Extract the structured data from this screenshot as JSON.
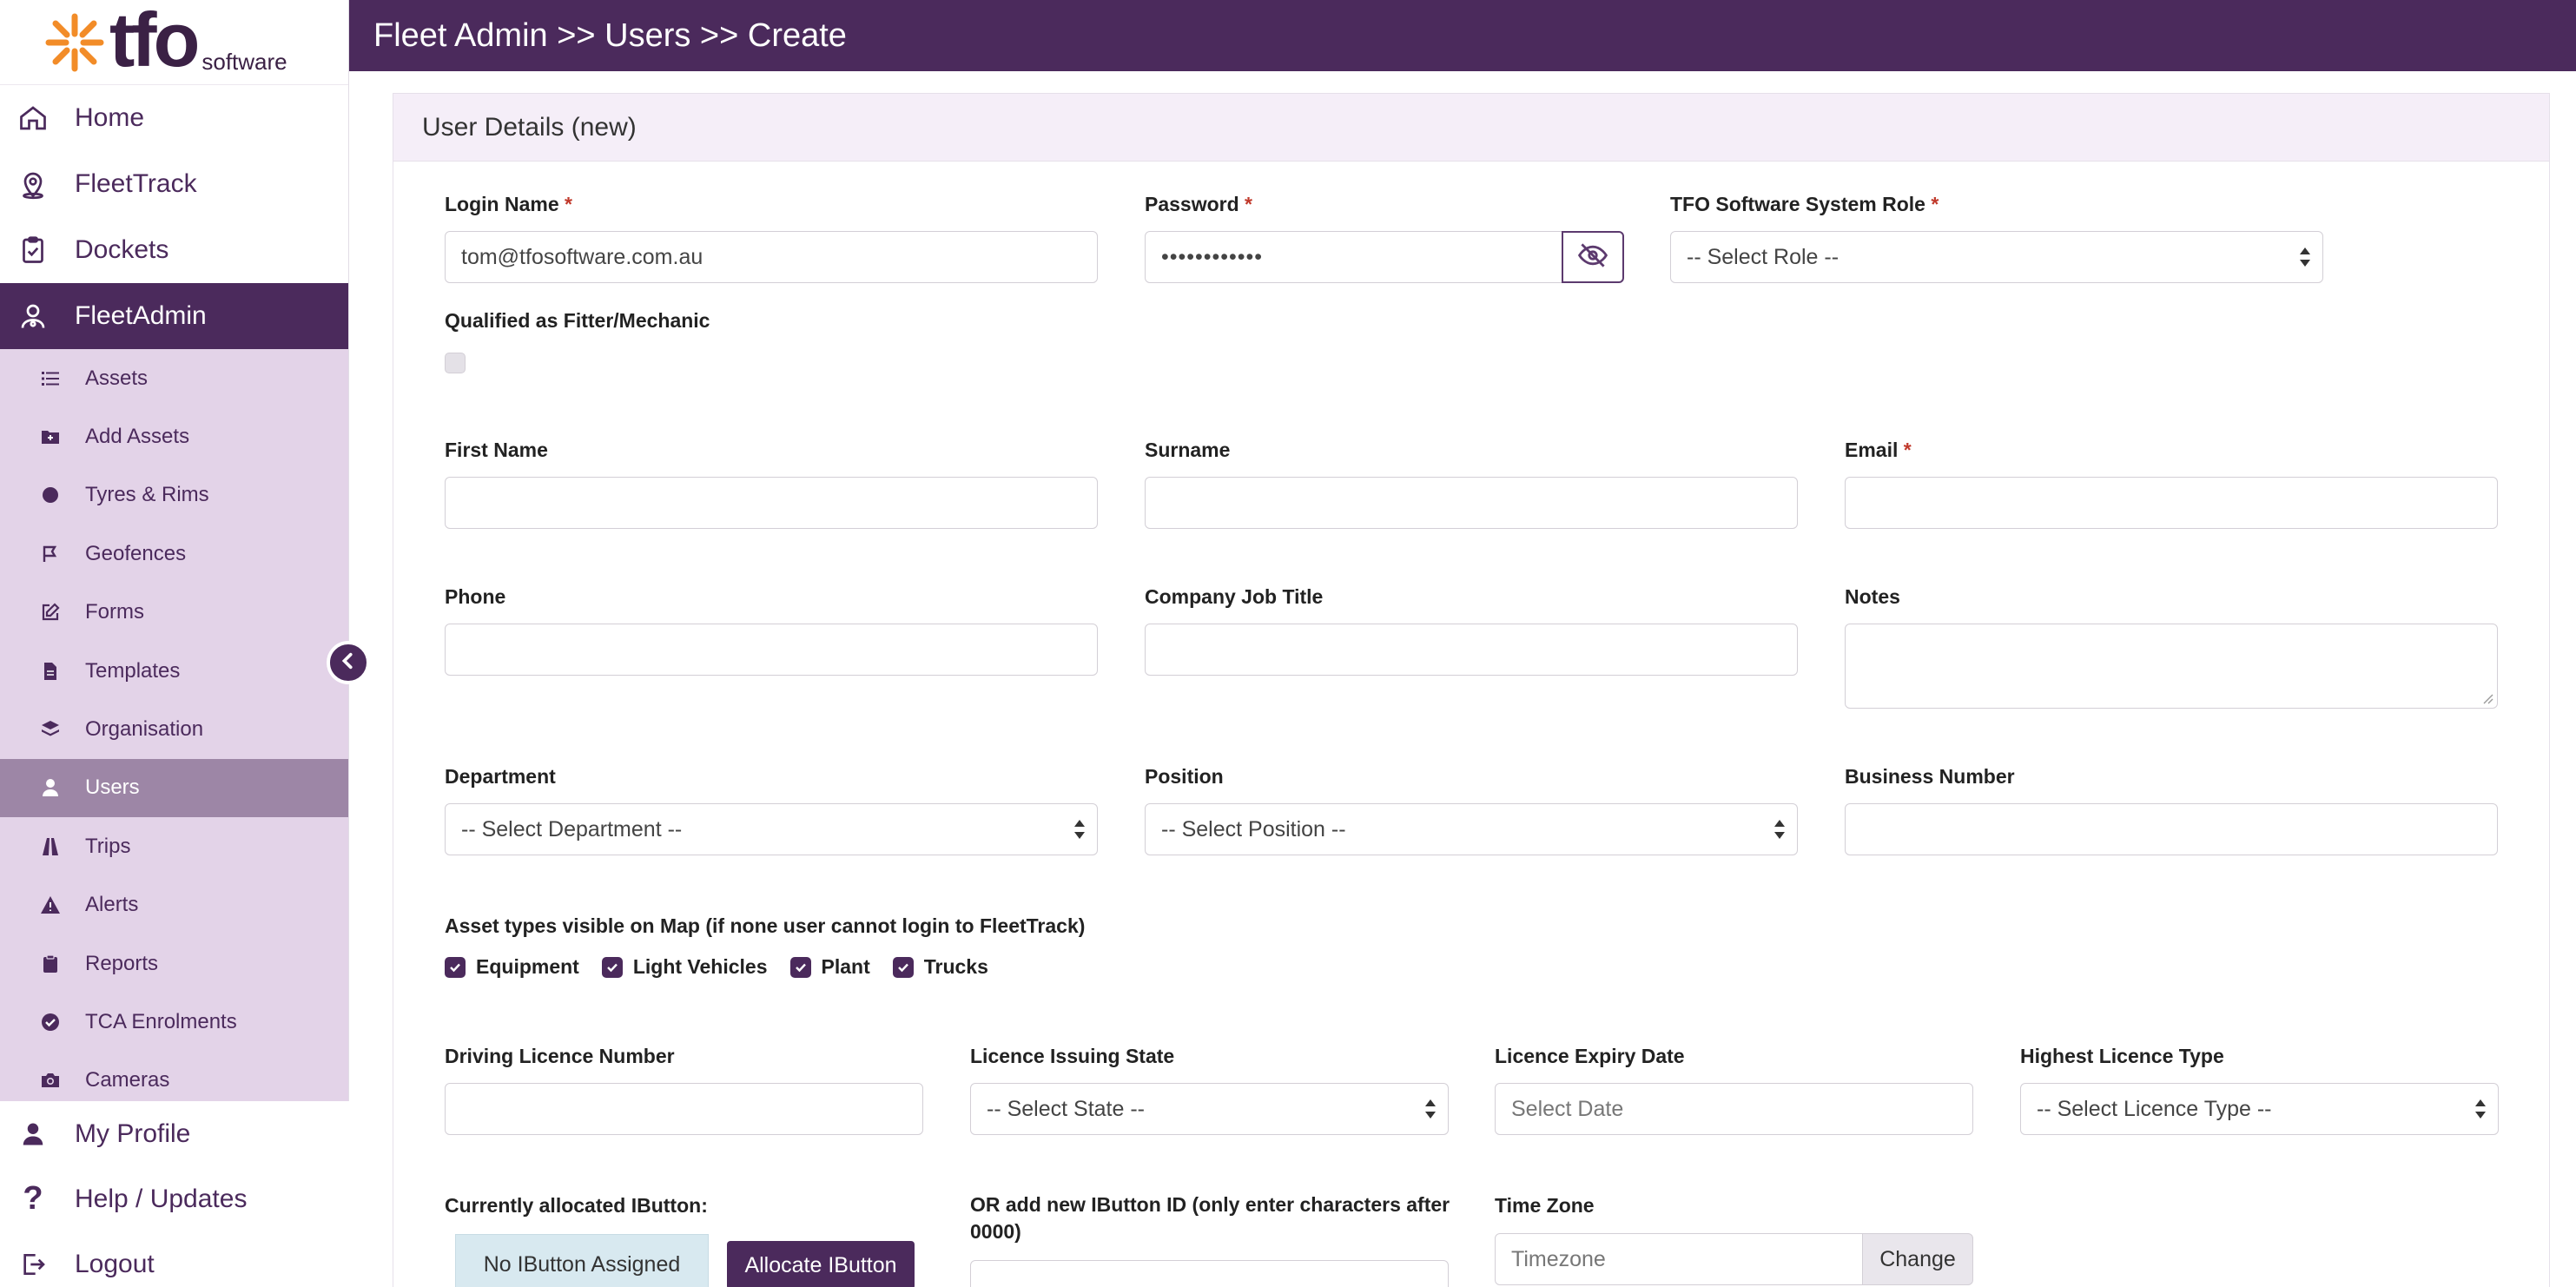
{
  "brand": {
    "logo_text": "tfo",
    "logo_sub": "software"
  },
  "header": {
    "breadcrumb": "Fleet Admin >> Users >> Create"
  },
  "sidebar": {
    "main_items": [
      {
        "label": "Home",
        "icon": "home-icon"
      },
      {
        "label": "FleetTrack",
        "icon": "map-pin-icon"
      },
      {
        "label": "Dockets",
        "icon": "clipboard-check-icon"
      },
      {
        "label": "FleetAdmin",
        "icon": "admin-user-icon",
        "active": true
      }
    ],
    "sub_items": [
      {
        "label": "Assets",
        "icon": "list-icon"
      },
      {
        "label": "Add Assets",
        "icon": "folder-plus-icon"
      },
      {
        "label": "Tyres & Rims",
        "icon": "circle-icon"
      },
      {
        "label": "Geofences",
        "icon": "flag-icon"
      },
      {
        "label": "Forms",
        "icon": "edit-icon"
      },
      {
        "label": "Templates",
        "icon": "file-icon"
      },
      {
        "label": "Organisation",
        "icon": "layers-icon"
      },
      {
        "label": "Users",
        "icon": "user-icon",
        "active": true
      },
      {
        "label": "Trips",
        "icon": "road-icon"
      },
      {
        "label": "Alerts",
        "icon": "warning-icon"
      },
      {
        "label": "Reports",
        "icon": "clipboard-icon"
      },
      {
        "label": "TCA Enrolments",
        "icon": "check-circle-icon"
      },
      {
        "label": "Cameras",
        "icon": "camera-icon"
      }
    ],
    "bottom_items": [
      {
        "label": "My Profile",
        "icon": "user-icon"
      },
      {
        "label": "Help / Updates",
        "icon": "question-icon"
      },
      {
        "label": "Logout",
        "icon": "logout-icon"
      }
    ]
  },
  "form": {
    "card_title": "User Details (new)",
    "required_mark": "*",
    "login_name": {
      "label": "Login Name",
      "value": "tom@tfosoftware.com.au"
    },
    "password": {
      "label": "Password",
      "value": "••••••••••••"
    },
    "role": {
      "label": "TFO Software System Role",
      "selected": "-- Select Role --"
    },
    "fitter": {
      "label": "Qualified as Fitter/Mechanic"
    },
    "first_name": {
      "label": "First Name",
      "value": ""
    },
    "surname": {
      "label": "Surname",
      "value": ""
    },
    "email": {
      "label": "Email",
      "value": ""
    },
    "phone": {
      "label": "Phone",
      "value": ""
    },
    "job_title": {
      "label": "Company Job Title",
      "value": ""
    },
    "notes": {
      "label": "Notes",
      "value": ""
    },
    "department": {
      "label": "Department",
      "selected": "-- Select Department --"
    },
    "position": {
      "label": "Position",
      "selected": "-- Select Position --"
    },
    "business_number": {
      "label": "Business Number",
      "value": ""
    },
    "asset_types": {
      "label": "Asset types visible on Map (if none user cannot login to FleetTrack)",
      "options": [
        {
          "label": "Equipment",
          "checked": true
        },
        {
          "label": "Light Vehicles",
          "checked": true
        },
        {
          "label": "Plant",
          "checked": true
        },
        {
          "label": "Trucks",
          "checked": true
        }
      ]
    },
    "licence_number": {
      "label": "Driving Licence Number",
      "value": ""
    },
    "licence_state": {
      "label": "Licence Issuing State",
      "selected": "-- Select State --"
    },
    "licence_expiry": {
      "label": "Licence Expiry Date",
      "placeholder": "Select Date"
    },
    "licence_type": {
      "label": "Highest Licence Type",
      "selected": "-- Select Licence Type --"
    },
    "ibutton": {
      "label": "Currently allocated IButton:",
      "status": "No IButton Assigned",
      "allocate_label": "Allocate IButton"
    },
    "new_ibutton": {
      "label": "OR add new IButton ID (only enter characters after 0000)",
      "value": ""
    },
    "timezone": {
      "label": "Time Zone",
      "placeholder": "Timezone",
      "change_label": "Change"
    }
  }
}
